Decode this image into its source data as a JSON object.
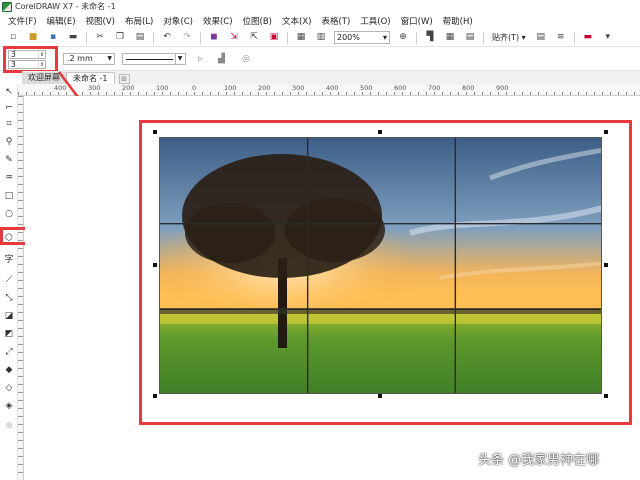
{
  "window": {
    "title": "CorelDRAW X7 - 未命名 -1"
  },
  "menu": {
    "items": [
      "文件(F)",
      "编辑(E)",
      "视图(V)",
      "布局(L)",
      "对象(C)",
      "效果(C)",
      "位图(B)",
      "文本(X)",
      "表格(T)",
      "工具(O)",
      "窗口(W)",
      "帮助(H)"
    ]
  },
  "toolbar": {
    "zoom_value": "200%",
    "snap_label": "贴齐(T)"
  },
  "propbar": {
    "rows_value": "3",
    "cols_value": "3",
    "outline_width": ".2 mm"
  },
  "tabs": {
    "welcome": "欢迎屏幕",
    "document": "未命名 -1"
  },
  "ruler": {
    "ticks": [
      "400",
      "300",
      "200",
      "100",
      "0",
      "100",
      "200",
      "300",
      "400",
      "500",
      "600",
      "700",
      "800",
      "900"
    ]
  },
  "grid": {
    "rows": 3,
    "columns": 3
  },
  "colors": {
    "highlight": "#e8393c",
    "grid_line": "#2a2a2a"
  },
  "watermark": {
    "text": "头条 @我家男神在哪"
  }
}
